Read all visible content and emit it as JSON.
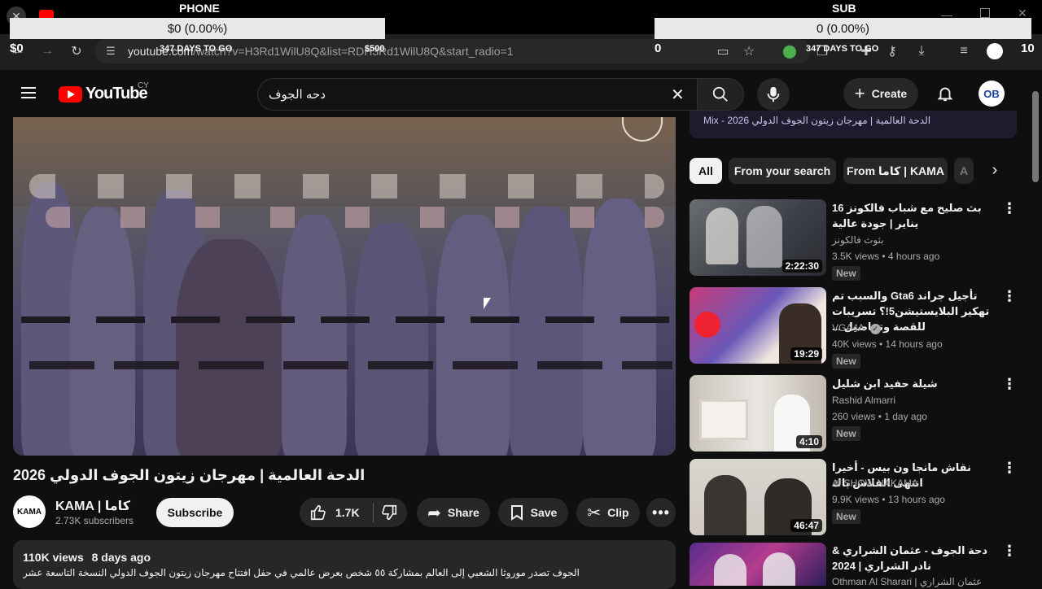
{
  "browser": {
    "url_host": "youtube.com",
    "url_path": "/watch?v=H3Rd1WilU8Q&list=RDH3Rd1WilU8Q&start_radio=1"
  },
  "ticker": {
    "left_head": "PHONE",
    "left_value": "$0 (0.00%)",
    "left_small_a": "$0",
    "left_small_days": "347 DAYS TO GO",
    "left_small_goal": "$500",
    "right_head": "SUB",
    "right_value": "0 (0.00%)",
    "right_num_a": "0",
    "right_small_days": "347 DAYS TO GO",
    "right_num_b": "10"
  },
  "header": {
    "logo_text": "YouTube",
    "logo_country": "CY",
    "search_query": "دحه الجوف",
    "create_label": "Create",
    "avatar_text": "OB"
  },
  "video": {
    "title": "الدحة العالمية | مهرجان زيتون الجوف الدولي 2026",
    "channel_logo_text": "KAMA",
    "channel_name": "KAMA | كاما",
    "subscribers": "2.73K subscribers",
    "subscribe_label": "Subscribe",
    "likes": "1.7K",
    "share_label": "Share",
    "save_label": "Save",
    "clip_label": "Clip",
    "views": "110K views",
    "age": "8 days ago",
    "description": "الجوف تصدر موروثا الشعبي إلى العالم بمشاركة ٥٥ شخص بعرض عالمي في حفل افتتاح مهرجان زيتون الجوف الدولي النسخة التاسعة عشر"
  },
  "sidebar": {
    "mix_title": "Mix - الدحة العالمية | مهرجان زيتون الجوف الدولي 2026",
    "chips": [
      "All",
      "From your search",
      "From كاما | KAMA",
      "A"
    ],
    "items": [
      {
        "title": "بث صليح مع شباب فالكونز 16 يناير | جودة عالية",
        "channel": "بثوث فالكونز",
        "meta": "3.5K views • 4 hours ago",
        "duration": "2:22:30",
        "badge": "New"
      },
      {
        "title": "تأجيل جراند Gta6 والسبب تم تهكير البلايستيشن5!؟ تسريبات للقصة وتفاصيل ...",
        "channel": "VGA4A",
        "meta": "40K views • 14 hours ago",
        "duration": "19:29",
        "badge": "New"
      },
      {
        "title": "شيلة حفيد ابن شليل",
        "channel": "Rashid Almarri",
        "meta": "260 views • 1 day ago",
        "duration": "4:10",
        "badge": "New"
      },
      {
        "title": "نقاش مانجا ون بيس - أخيرا انتهى الفلاش باك",
        "channel": "AI SHOW NAKAMA",
        "meta": "9.9K views • 13 hours ago",
        "duration": "46:47",
        "badge": "New"
      },
      {
        "title": "دحة الجوف - عثمان الشراري & نادر الشراري | 2024",
        "channel": "Othman Al Sharari | عثمان الشراري",
        "meta": "",
        "duration": "",
        "badge": ""
      }
    ]
  }
}
